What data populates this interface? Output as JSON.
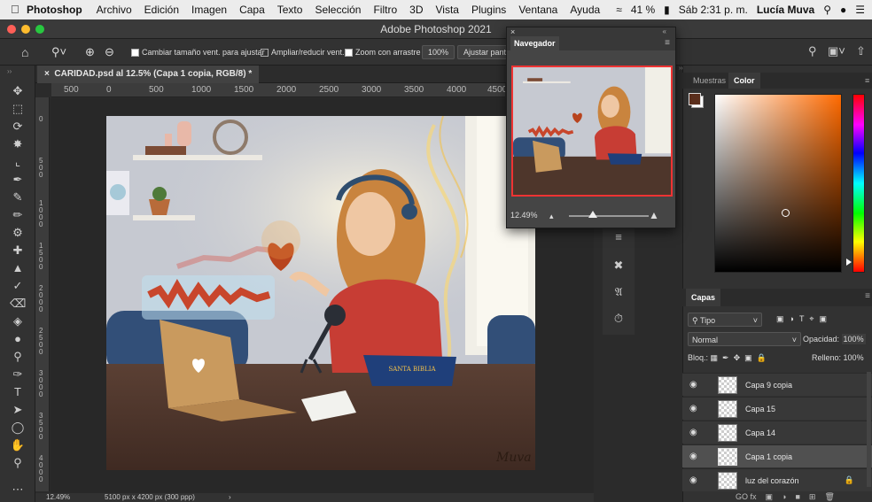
{
  "menubar": {
    "app": "Photoshop",
    "items": [
      "Archivo",
      "Edición",
      "Imagen",
      "Capa",
      "Texto",
      "Selección",
      "Filtro",
      "3D",
      "Vista",
      "Plugins",
      "Ventana",
      "Ayuda"
    ],
    "battery": "41 %",
    "clock": "Sáb 2:31 p. m.",
    "user": "Lucía Muva"
  },
  "window": {
    "title": "Adobe Photoshop 2021"
  },
  "options": {
    "resize_label": "Cambiar tamaño vent. para ajustar",
    "zoom_all_label": "Ampliar/reducir vent.",
    "scrubby_label": "Zoom con arrastre",
    "zoom_value": "100%",
    "fit_label": "Ajustar pant."
  },
  "document": {
    "tab_title": "CARIDAD.psd al 12.5% (Capa 1 copia, RGB/8) *",
    "ruler_h": [
      "500",
      "0",
      "500",
      "1000",
      "1500",
      "2000",
      "2500",
      "3000",
      "3500",
      "4000",
      "4500"
    ],
    "ruler_v": [
      "0",
      "5\n0\n0",
      "1\n0\n0\n0",
      "1\n5\n0\n0",
      "2\n0\n0\n0",
      "2\n5\n0\n0",
      "3\n0\n0\n0",
      "3\n5\n0\n0",
      "4\n0\n0\n0"
    ],
    "signature": "Muva",
    "book_text": "SANTA BIBLIA"
  },
  "status": {
    "zoom": "12.49%",
    "size": "5100 px x 4200 px (300 ppp)"
  },
  "navigator": {
    "title": "Navegador",
    "zoom": "12.49%"
  },
  "color_panel": {
    "tabs": [
      "Muestras",
      "Color"
    ],
    "fg_color": "#5a2e1c",
    "bg_color": "#ffffff"
  },
  "layers": {
    "title": "Capas",
    "filter": "Tipo",
    "blend": "Normal",
    "opacity_label": "Opacidad:",
    "opacity_value": "100%",
    "lock_label": "Bloq.:",
    "fill_label": "Relleno:",
    "fill_value": "100%",
    "items": [
      {
        "name": "Capa 9 copia",
        "selected": false
      },
      {
        "name": "Capa 15",
        "selected": false
      },
      {
        "name": "Capa 14",
        "selected": false
      },
      {
        "name": "Capa 1 copia",
        "selected": true
      },
      {
        "name": "luz del corazón",
        "selected": false
      }
    ],
    "footer": "GO fx"
  }
}
